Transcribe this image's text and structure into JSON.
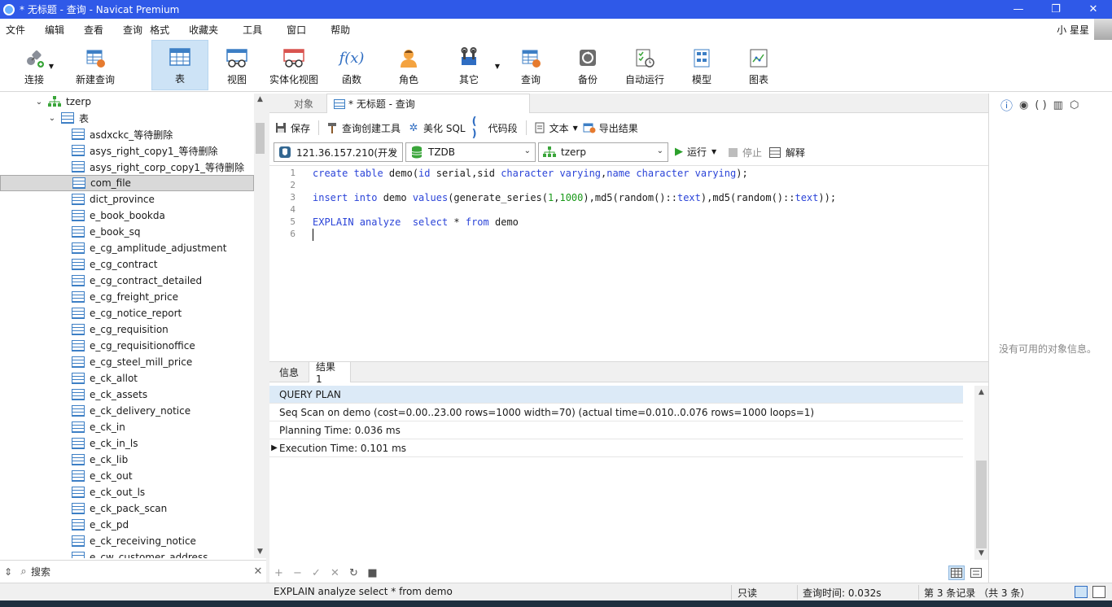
{
  "window": {
    "title": "* 无标题 - 查询 - Navicat Premium",
    "controls": [
      "—",
      "❐",
      "✕"
    ]
  },
  "menu": {
    "items": [
      "文件",
      "编辑",
      "查看",
      "查询",
      "格式",
      "收藏夹",
      "工具",
      "窗口",
      "帮助"
    ],
    "user_name": "小 星星"
  },
  "toolbar": {
    "items": [
      {
        "label": "连接",
        "icon": "connection-icon"
      },
      {
        "label": "新建查询",
        "icon": "new-query-icon"
      },
      {
        "label": "表",
        "icon": "table-icon",
        "active": true
      },
      {
        "label": "视图",
        "icon": "view-icon"
      },
      {
        "label": "实体化视图",
        "icon": "materialized-view-icon"
      },
      {
        "label": "函数",
        "icon": "function-icon"
      },
      {
        "label": "角色",
        "icon": "role-icon"
      },
      {
        "label": "其它",
        "icon": "other-icon"
      },
      {
        "label": "查询",
        "icon": "query-icon"
      },
      {
        "label": "备份",
        "icon": "backup-icon"
      },
      {
        "label": "自动运行",
        "icon": "automation-icon"
      },
      {
        "label": "模型",
        "icon": "model-icon"
      },
      {
        "label": "图表",
        "icon": "chart-icon"
      }
    ],
    "function_glyph": "f(x)"
  },
  "tree": {
    "schema": "tzerp",
    "folder": "表",
    "tables": [
      "asdxckc_等待删除",
      "asys_right_copy1_等待删除",
      "asys_right_corp_copy1_等待删除",
      "com_file",
      "dict_province",
      "e_book_bookda",
      "e_book_sq",
      "e_cg_amplitude_adjustment",
      "e_cg_contract",
      "e_cg_contract_detailed",
      "e_cg_freight_price",
      "e_cg_notice_report",
      "e_cg_requisition",
      "e_cg_requisitionoffice",
      "e_cg_steel_mill_price",
      "e_ck_allot",
      "e_ck_assets",
      "e_ck_delivery_notice",
      "e_ck_in",
      "e_ck_in_ls",
      "e_ck_lib",
      "e_ck_out",
      "e_ck_out_ls",
      "e_ck_pack_scan",
      "e_ck_pd",
      "e_ck_receiving_notice",
      "e_cw_customer_address"
    ],
    "selected": "com_file",
    "search_placeholder": "搜索"
  },
  "tabs": {
    "objects": "对象",
    "query": "* 无标题 - 查询"
  },
  "query_toolbar": {
    "save": "保存",
    "builder": "查询创建工具",
    "beautify": "美化 SQL",
    "snippet": "代码段",
    "text": "文本",
    "export": "导出结果"
  },
  "selectors": {
    "connection": "121.36.157.210(开发",
    "database": "TZDB",
    "schema": "tzerp",
    "run": "运行",
    "stop": "停止",
    "explain": "解释"
  },
  "editor": {
    "line_numbers": [
      "1",
      "2",
      "3",
      "4",
      "5",
      "6"
    ],
    "lines": [
      [
        {
          "t": "create table ",
          "c": "kw"
        },
        {
          "t": "demo(",
          "c": "plain"
        },
        {
          "t": "id",
          "c": "kw"
        },
        {
          "t": " serial,sid ",
          "c": "plain"
        },
        {
          "t": "character varying",
          "c": "kw"
        },
        {
          "t": ",",
          "c": "plain"
        },
        {
          "t": "name",
          "c": "kw"
        },
        {
          "t": " ",
          "c": "plain"
        },
        {
          "t": "character varying",
          "c": "kw"
        },
        {
          "t": ");",
          "c": "plain"
        }
      ],
      [],
      [
        {
          "t": "insert into ",
          "c": "kw"
        },
        {
          "t": "demo ",
          "c": "plain"
        },
        {
          "t": "values",
          "c": "kw"
        },
        {
          "t": "(generate_series(",
          "c": "plain"
        },
        {
          "t": "1",
          "c": "num"
        },
        {
          "t": ",",
          "c": "plain"
        },
        {
          "t": "1000",
          "c": "num"
        },
        {
          "t": "),md5(random()::",
          "c": "plain"
        },
        {
          "t": "text",
          "c": "kw"
        },
        {
          "t": "),md5(random()::",
          "c": "plain"
        },
        {
          "t": "text",
          "c": "kw"
        },
        {
          "t": "));",
          "c": "plain"
        }
      ],
      [],
      [
        {
          "t": "EXPLAIN analyze  select",
          "c": "kw"
        },
        {
          "t": " * ",
          "c": "plain"
        },
        {
          "t": "from",
          "c": "kw"
        },
        {
          "t": " demo",
          "c": "plain"
        }
      ],
      []
    ]
  },
  "result_tabs": {
    "info": "信息",
    "result1": "结果 1"
  },
  "result": {
    "header": "QUERY PLAN",
    "rows": [
      "Seq Scan on demo  (cost=0.00..23.00 rows=1000 width=70) (actual time=0.010..0.076 rows=1000 loops=1)",
      "Planning Time: 0.036 ms",
      "Execution Time: 0.101 ms"
    ],
    "current_row_index": 2
  },
  "grid_actions": [
    "+",
    "−",
    "✓",
    "✕",
    "↻",
    "■"
  ],
  "right_panel": {
    "empty_text": "没有可用的对象信息。"
  },
  "status": {
    "sql": "EXPLAIN analyze  select * from demo",
    "readonly": "只读",
    "query_time": "查询时间: 0.032s",
    "records": "第 3 条记录 （共 3 条）"
  }
}
